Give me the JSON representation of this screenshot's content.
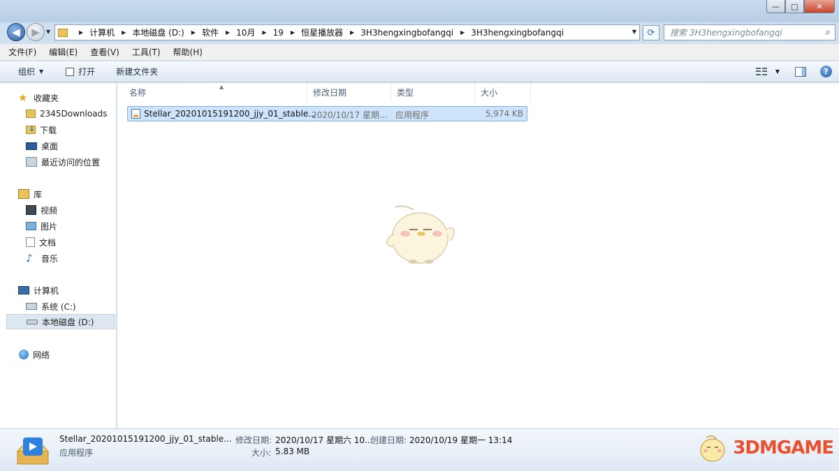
{
  "window": {
    "buttons": [
      "—",
      "□",
      "✕"
    ]
  },
  "nav": {
    "breadcrumbs": [
      "计算机",
      "本地磁盘 (D:)",
      "软件",
      "10月",
      "19",
      "恒星播放器",
      "3H3hengxingbofangqi",
      "3H3hengxingbofangqi"
    ],
    "search_placeholder": "搜索 3H3hengxingbofangqi"
  },
  "menu": [
    "文件(F)",
    "编辑(E)",
    "查看(V)",
    "工具(T)",
    "帮助(H)"
  ],
  "toolbar": {
    "organize": "组织",
    "open": "打开",
    "new_folder": "新建文件夹"
  },
  "sidebar": {
    "favorites": {
      "label": "收藏夹",
      "items": [
        "2345Downloads",
        "下载",
        "桌面",
        "最近访问的位置"
      ]
    },
    "libraries": {
      "label": "库",
      "items": [
        "视频",
        "图片",
        "文档",
        "音乐"
      ]
    },
    "computer": {
      "label": "计算机",
      "items": [
        "系统 (C:)",
        "本地磁盘 (D:)"
      ]
    },
    "network": {
      "label": "网络"
    }
  },
  "columns": [
    "名称",
    "修改日期",
    "类型",
    "大小"
  ],
  "files": [
    {
      "name": "Stellar_20201015191200_jjy_01_stable...",
      "date": "2020/10/17 星期...",
      "type": "应用程序",
      "size": "5,974 KB"
    }
  ],
  "details": {
    "name": "Stellar_20201015191200_jjy_01_stable...",
    "type": "应用程序",
    "modified_label": "修改日期:",
    "modified_value": "2020/10/17 星期六 10...",
    "created_label": "创建日期:",
    "created_value": "2020/10/19 星期一 13:14",
    "size_label": "大小:",
    "size_value": "5.83 MB"
  },
  "watermark": "3DMGAME"
}
